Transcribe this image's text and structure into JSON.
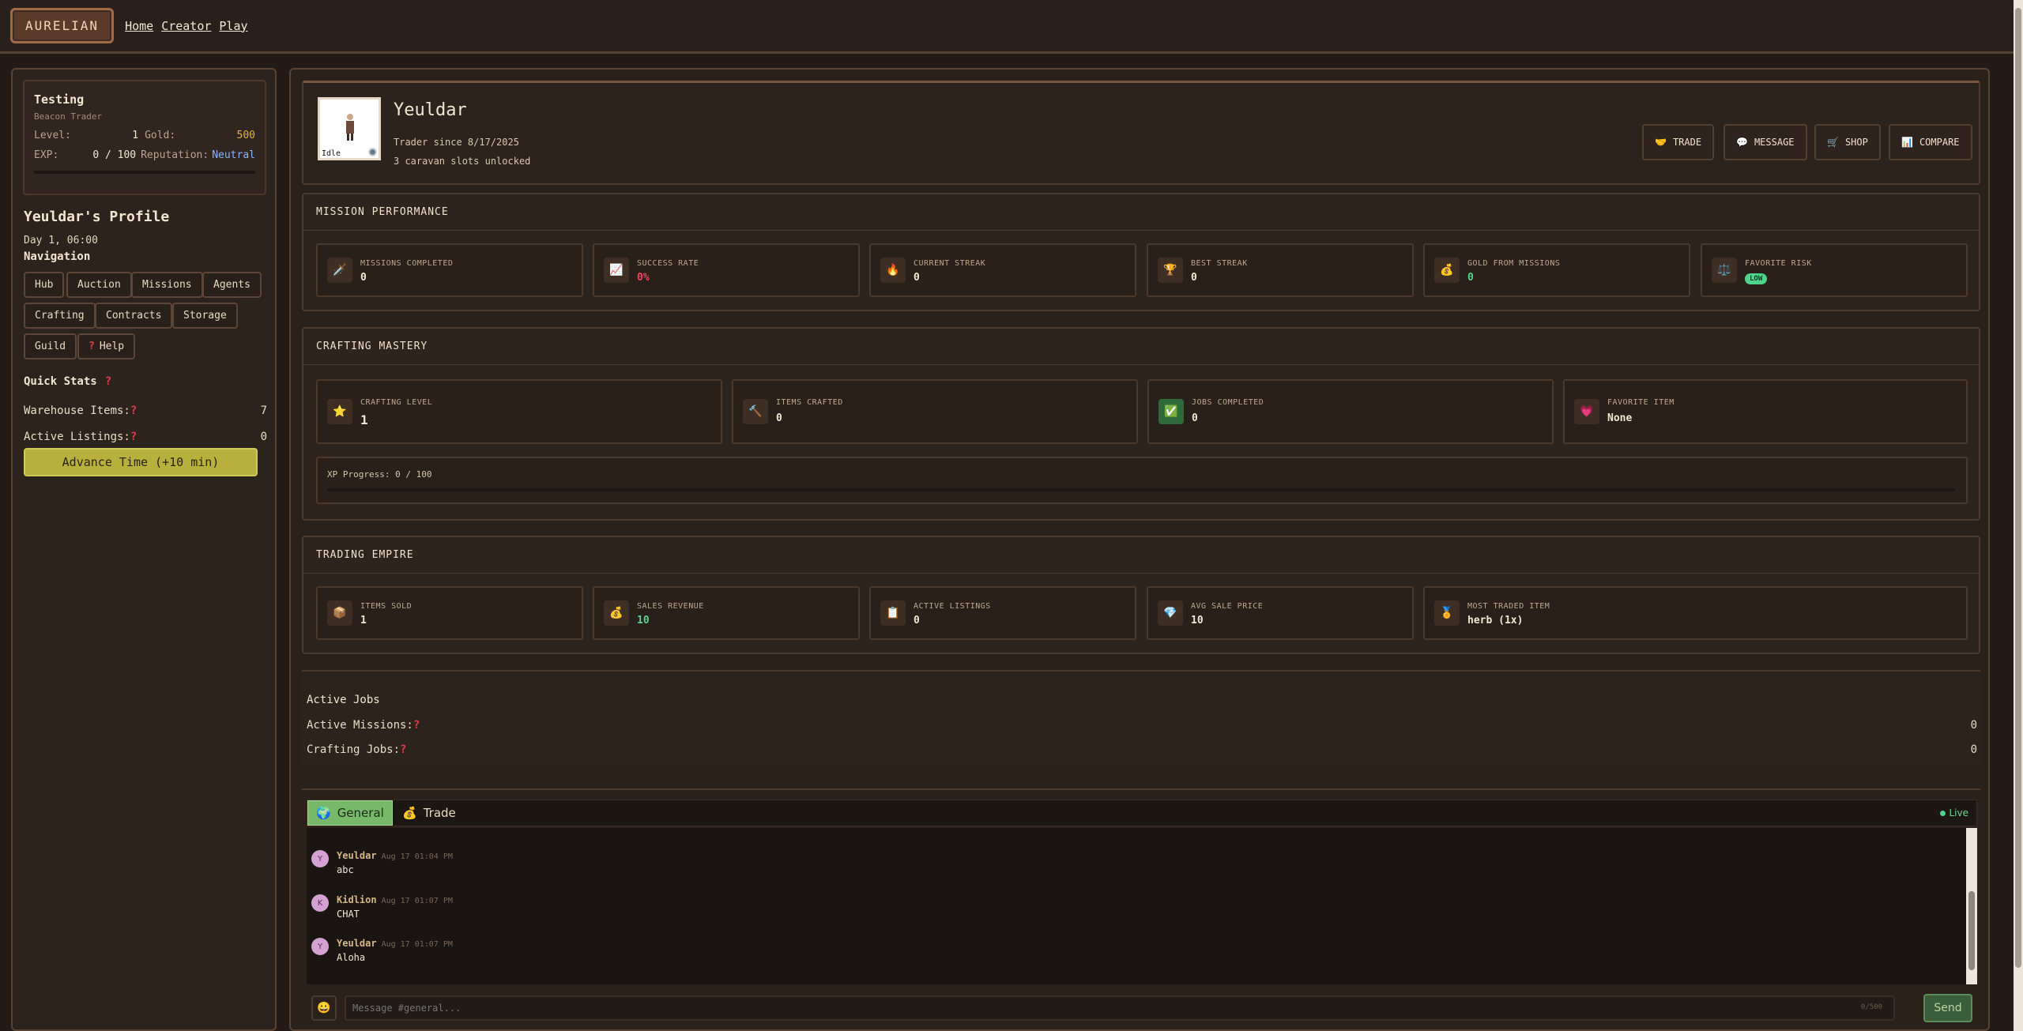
{
  "topbar": {
    "brand": "AURELIAN",
    "links": [
      "Home",
      "Creator",
      "Play"
    ]
  },
  "player": {
    "name": "Testing",
    "rank": "Beacon Trader",
    "level_label": "Level:",
    "level": "1",
    "gold_label": "Gold:",
    "gold": "500",
    "exp_label": "EXP:",
    "exp": "0 / 100",
    "reputation_label": "Reputation:",
    "reputation": "Neutral",
    "exp_progress": 0
  },
  "sidebar": {
    "profile_title": "Yeuldar's Profile",
    "daytime": "Day 1, 06:00",
    "nav_title": "Navigation",
    "nav": [
      "Hub",
      "Auction",
      "Missions",
      "Agents",
      "Crafting",
      "Contracts",
      "Storage",
      "Guild",
      "Help"
    ],
    "quick_stats_title": "Quick Stats",
    "warehouse_label": "Warehouse Items:",
    "warehouse_value": "7",
    "listings_label": "Active Listings:",
    "listings_value": "0",
    "advance_label": "Advance Time (+10 min)"
  },
  "profile": {
    "name": "Yeuldar",
    "status": "Idle",
    "since": "Trader since 8/17/2025",
    "slots": "3 caravan slots unlocked",
    "actions": [
      {
        "label": "TRADE",
        "icon": "handshake-icon"
      },
      {
        "label": "MESSAGE",
        "icon": "speech-bubble-icon"
      },
      {
        "label": "SHOP",
        "icon": "cart-icon"
      },
      {
        "label": "COMPARE",
        "icon": "bar-chart-icon"
      }
    ]
  },
  "mission": {
    "title": "MISSION PERFORMANCE",
    "tiles": [
      {
        "label": "MISSIONS COMPLETED",
        "value": "0",
        "icon": "sword-icon"
      },
      {
        "label": "SUCCESS RATE",
        "value": "0%",
        "icon": "trend-chart-icon"
      },
      {
        "label": "CURRENT STREAK",
        "value": "0",
        "icon": "fire-icon"
      },
      {
        "label": "BEST STREAK",
        "value": "0",
        "icon": "trophy-icon"
      },
      {
        "label": "GOLD FROM MISSIONS",
        "value": "0",
        "icon": "money-bag-icon"
      },
      {
        "label": "FAVORITE RISK",
        "value": "LOW",
        "icon": "scales-icon"
      }
    ]
  },
  "crafting": {
    "title": "CRAFTING MASTERY",
    "tiles": [
      {
        "label": "CRAFTING LEVEL",
        "value": "1",
        "icon": "star-icon"
      },
      {
        "label": "ITEMS CRAFTED",
        "value": "0",
        "icon": "hammer-icon"
      },
      {
        "label": "JOBS COMPLETED",
        "value": "0",
        "icon": "checkmark-icon"
      },
      {
        "label": "FAVORITE ITEM",
        "value": "None",
        "icon": "heart-icon"
      }
    ],
    "xp_label": "XP Progress: 0 / 100",
    "xp_progress": 0
  },
  "trading": {
    "title": "TRADING EMPIRE",
    "tiles": [
      {
        "label": "ITEMS SOLD",
        "value": "1",
        "icon": "package-icon"
      },
      {
        "label": "SALES REVENUE",
        "value": "10",
        "icon": "money-bag-icon"
      },
      {
        "label": "ACTIVE LISTINGS",
        "value": "0",
        "icon": "clipboard-icon"
      },
      {
        "label": "AVG SALE PRICE",
        "value": "10",
        "icon": "gem-icon"
      },
      {
        "label": "MOST TRADED ITEM",
        "value": "herb (1x)",
        "icon": "medal-icon"
      }
    ]
  },
  "jobs": {
    "title": "Active Jobs",
    "missions_label": "Active Missions:",
    "missions_value": "0",
    "crafting_label": "Crafting Jobs:",
    "crafting_value": "0"
  },
  "chat": {
    "tabs": [
      {
        "label": "General",
        "icon": "globe-icon"
      },
      {
        "label": "Trade",
        "icon": "money-bag-icon"
      }
    ],
    "live_label": "Live",
    "messages": [
      {
        "initial": "Y",
        "name": "Yeuldar",
        "time": "Aug 17 01:04 PM",
        "text": "abc"
      },
      {
        "initial": "K",
        "name": "Kidlion",
        "time": "Aug 17 01:07 PM",
        "text": "CHAT"
      },
      {
        "initial": "Y",
        "name": "Yeuldar",
        "time": "Aug 17 01:07 PM",
        "text": "Aloha"
      }
    ],
    "input_placeholder": "Message #general...",
    "counter": "0/500",
    "send_label": "Send"
  }
}
